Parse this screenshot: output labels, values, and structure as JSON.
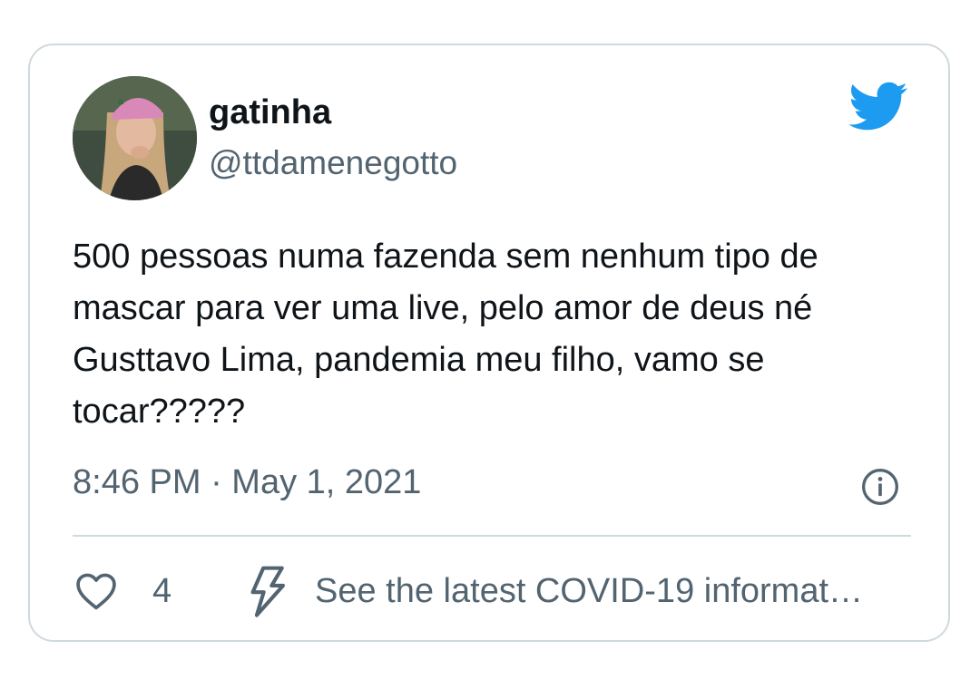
{
  "tweet": {
    "author": {
      "display_name": "gatinha",
      "handle": "@ttdamenegotto"
    },
    "text": "500 pessoas numa fazenda sem nenhum tipo de mascar para ver uma live, pelo amor de deus né Gusttavo Lima, pandemia meu filho, vamo se tocar?????",
    "timestamp": "8:46 PM · May 1, 2021",
    "likes": "4",
    "covid_link_text": "See the latest COVID-19 informat…"
  },
  "icons": {
    "brand": "twitter-bird-icon",
    "info": "info-icon",
    "like": "heart-icon",
    "covid": "lightning-bolt-icon"
  },
  "colors": {
    "twitter_blue": "#1d9bf0",
    "text_primary": "#0f1419",
    "text_secondary": "#536471",
    "border": "#cfd9de"
  }
}
